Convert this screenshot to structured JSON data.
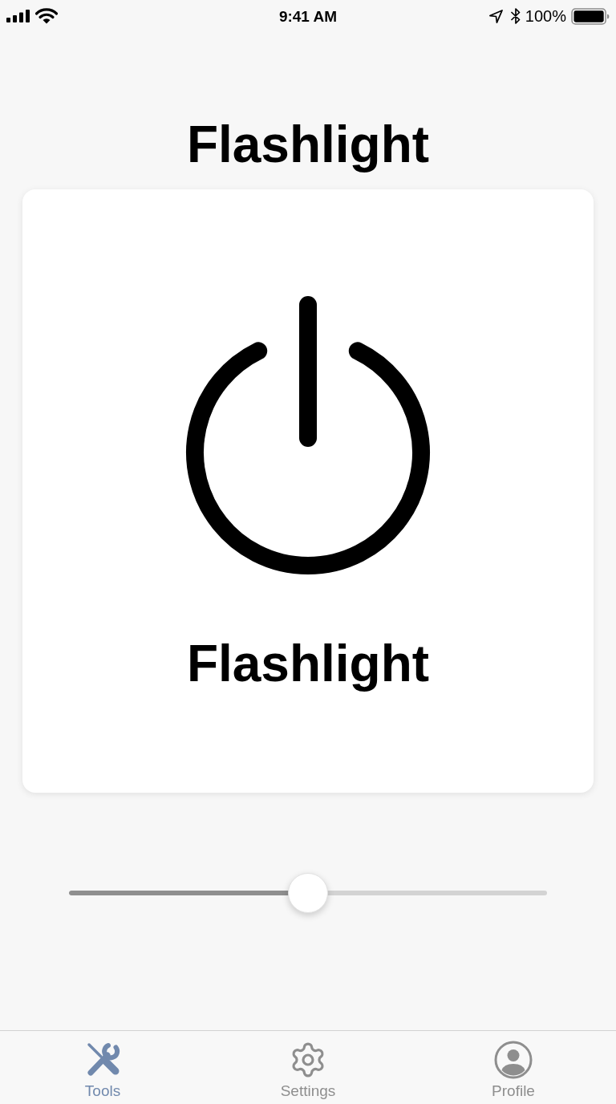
{
  "status_bar": {
    "time": "9:41 AM",
    "battery": "100%"
  },
  "title": "Flashlight",
  "card": {
    "label": "Flashlight"
  },
  "slider": {
    "level": 0.5
  },
  "tab_bar": {
    "tabs": [
      {
        "label": "Tools",
        "selected": true
      },
      {
        "label": "Settings",
        "selected": false
      },
      {
        "label": "Profile",
        "selected": false
      }
    ]
  }
}
